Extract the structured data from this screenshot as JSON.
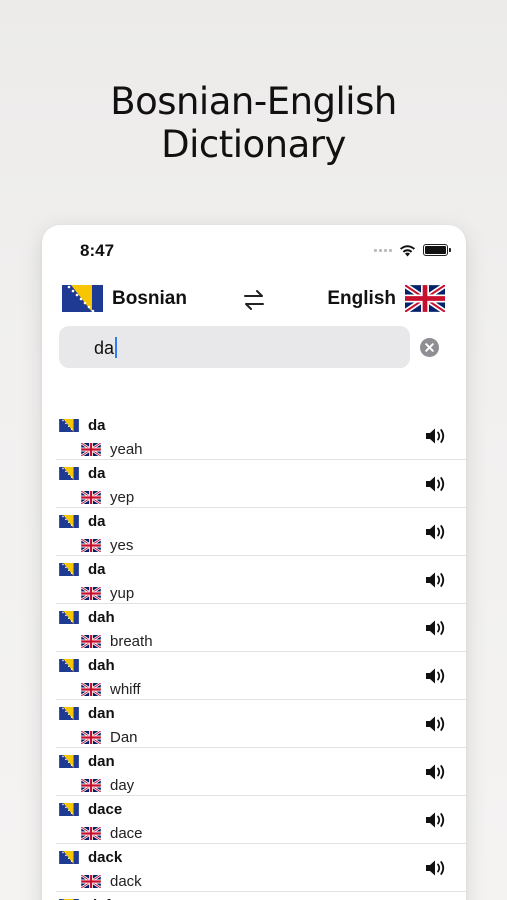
{
  "headline": {
    "line1": "Bosnian-English",
    "line2": "Dictionary"
  },
  "status": {
    "time": "8:47"
  },
  "languages": {
    "source": "Bosnian",
    "target": "English"
  },
  "search": {
    "value": "da"
  },
  "results": [
    {
      "word": "da",
      "translation": "yeah"
    },
    {
      "word": "da",
      "translation": "yep"
    },
    {
      "word": "da",
      "translation": "yes"
    },
    {
      "word": "da",
      "translation": "yup"
    },
    {
      "word": "dah",
      "translation": "breath"
    },
    {
      "word": "dah",
      "translation": "whiff"
    },
    {
      "word": "dan",
      "translation": "Dan"
    },
    {
      "word": "dan",
      "translation": "day"
    },
    {
      "word": "dace",
      "translation": "dace"
    },
    {
      "word": "dack",
      "translation": "dack"
    },
    {
      "word": "daft",
      "translation": ""
    }
  ],
  "icons": {
    "swap": "swap-arrows-icon",
    "clear": "clear-circle-icon",
    "speaker": "speaker-icon",
    "flag_source": "bosnia-flag-icon",
    "flag_target": "uk-flag-icon"
  }
}
